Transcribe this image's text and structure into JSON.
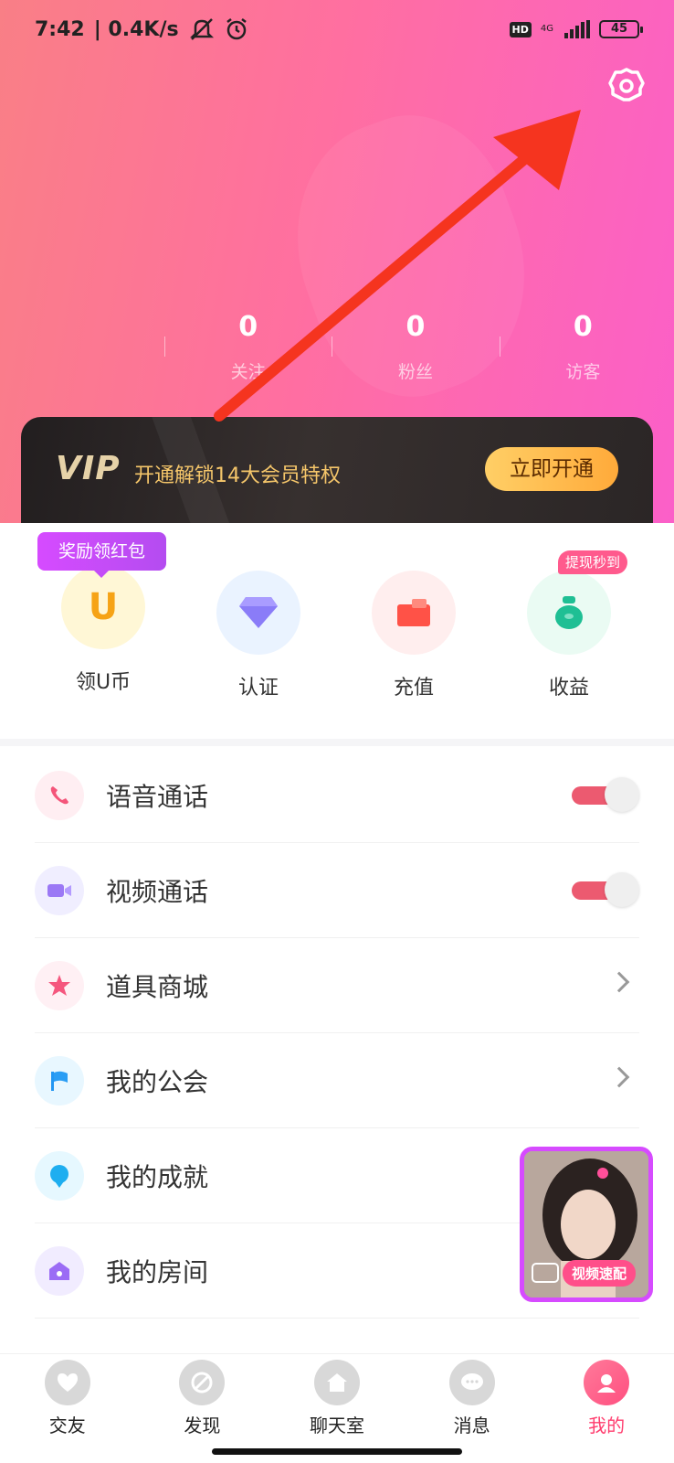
{
  "status_bar": {
    "time": "7:42",
    "speed": "| 0.4K/s",
    "network": "4G",
    "battery": "45",
    "hd_label": "HD"
  },
  "profile_stats": [
    {
      "value": "0",
      "label": "关注"
    },
    {
      "value": "0",
      "label": "粉丝"
    },
    {
      "value": "0",
      "label": "访客"
    }
  ],
  "vip_banner": {
    "logo": "VIP",
    "text": "开通解锁14大会员特权",
    "button": "立即开通"
  },
  "quick_actions": {
    "tooltip": "奖励领红包",
    "withdraw_badge": "提现秒到",
    "items": [
      {
        "label": "领U币",
        "icon": "u-coin-icon"
      },
      {
        "label": "认证",
        "icon": "diamond-icon"
      },
      {
        "label": "充值",
        "icon": "wallet-icon"
      },
      {
        "label": "收益",
        "icon": "money-bag-icon"
      }
    ]
  },
  "menu": [
    {
      "label": "语音通话",
      "control": "toggle",
      "enabled": true
    },
    {
      "label": "视频通话",
      "control": "toggle",
      "enabled": true
    },
    {
      "label": "道具商城",
      "control": "chevron"
    },
    {
      "label": "我的公会",
      "control": "chevron"
    },
    {
      "label": "我的成就",
      "control": "none"
    },
    {
      "label": "我的房间",
      "control": "none"
    }
  ],
  "floating_card": {
    "label": "视频速配"
  },
  "tabbar": [
    {
      "label": "交友",
      "icon": "heart-icon"
    },
    {
      "label": "发现",
      "icon": "compass-icon"
    },
    {
      "label": "聊天室",
      "icon": "house-icon"
    },
    {
      "label": "消息",
      "icon": "chat-icon"
    },
    {
      "label": "我的",
      "icon": "profile-icon",
      "active": true
    }
  ],
  "colors": {
    "accent": "#ff4f80",
    "vip_gold": "#f5c66a",
    "annotation_arrow": "#f5341f"
  }
}
